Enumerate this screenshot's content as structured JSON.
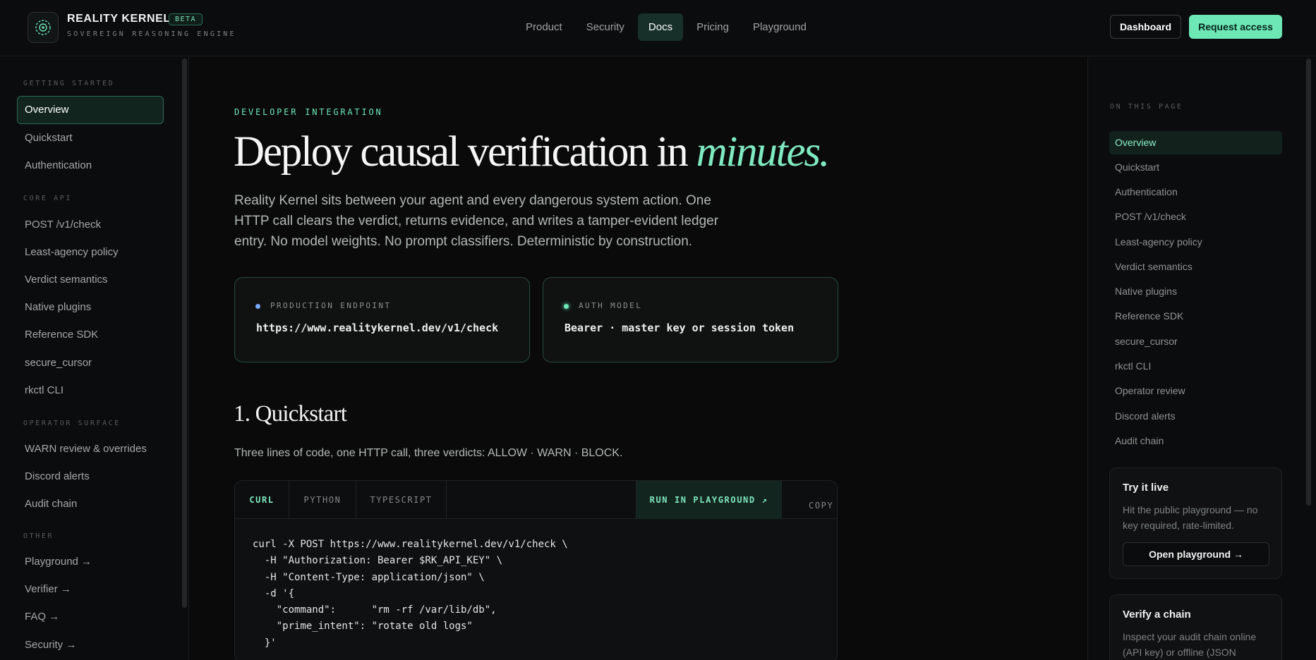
{
  "header": {
    "brand": "REALITY KERNEL",
    "badge": "BETA",
    "tagline": "SOVEREIGN REASONING ENGINE",
    "nav": [
      "Product",
      "Security",
      "Docs",
      "Pricing",
      "Playground"
    ],
    "active_nav": "Docs",
    "dashboard_label": "Dashboard",
    "request_label": "Request access",
    "accent": "#6ee7b7"
  },
  "sidebar": {
    "sections": [
      {
        "title": "GETTING STARTED",
        "items": [
          "Overview",
          "Quickstart",
          "Authentication"
        ]
      },
      {
        "title": "CORE API",
        "items": [
          "POST /v1/check",
          "Least-agency policy",
          "Verdict semantics",
          "Native plugins",
          "Reference SDK",
          "secure_cursor",
          "rkctl CLI"
        ]
      },
      {
        "title": "OPERATOR SURFACE",
        "items": [
          "WARN review & overrides",
          "Discord alerts",
          "Audit chain"
        ]
      },
      {
        "title": "OTHER",
        "items": [
          "Playground →",
          "Verifier →",
          "FAQ →",
          "Security →"
        ]
      }
    ],
    "active_item": "Overview"
  },
  "main": {
    "eyebrow": "DEVELOPER INTEGRATION",
    "hero_plain": "Deploy causal verification in ",
    "hero_em": "minutes.",
    "lede": "Reality Kernel sits between your agent and every dangerous system action. One HTTP call clears the verdict, returns evidence, and writes a tamper-evident ledger entry. No model weights. No prompt classifiers. Deterministic by construction.",
    "cards": [
      {
        "label": "PRODUCTION ENDPOINT",
        "value": "https://www.realitykernel.dev/v1/check",
        "dot_color": "#7aa7ff"
      },
      {
        "label": "AUTH MODEL",
        "value": "Bearer · master key or session token",
        "dot_color": "#6ee7b7"
      }
    ],
    "quickstart_title": "1. Quickstart",
    "quickstart_sub": "Three lines of code, one HTTP call, three verdicts: ALLOW · WARN · BLOCK.",
    "code_tabs": [
      "CURL",
      "PYTHON",
      "TYPESCRIPT"
    ],
    "active_tab": "CURL",
    "run_label": "RUN IN PLAYGROUND ↗",
    "copy_label": "COPY",
    "code_lines": [
      "curl -X POST https://www.realitykernel.dev/v1/check \\",
      "  -H \"Authorization: Bearer $RK_API_KEY\" \\",
      "  -H \"Content-Type: application/json\" \\",
      "  -d '{",
      "    \"command\":      \"rm -rf /var/lib/db\",",
      "    \"prime_intent\": \"rotate old logs\"",
      "  }'"
    ]
  },
  "rail": {
    "title": "ON THIS PAGE",
    "items": [
      "Overview",
      "Quickstart",
      "Authentication",
      "POST /v1/check",
      "Least-agency policy",
      "Verdict semantics",
      "Native plugins",
      "Reference SDK",
      "secure_cursor",
      "rkctl CLI",
      "Operator review",
      "Discord alerts",
      "Audit chain"
    ],
    "active_item": "Overview",
    "try_card": {
      "title": "Try it live",
      "desc": "Hit the public playground — no key required, rate-limited.",
      "button": "Open playground →"
    },
    "verify_card": {
      "title": "Verify a chain",
      "desc": "Inspect your audit chain online (API key) or offline (JSON export)."
    }
  }
}
